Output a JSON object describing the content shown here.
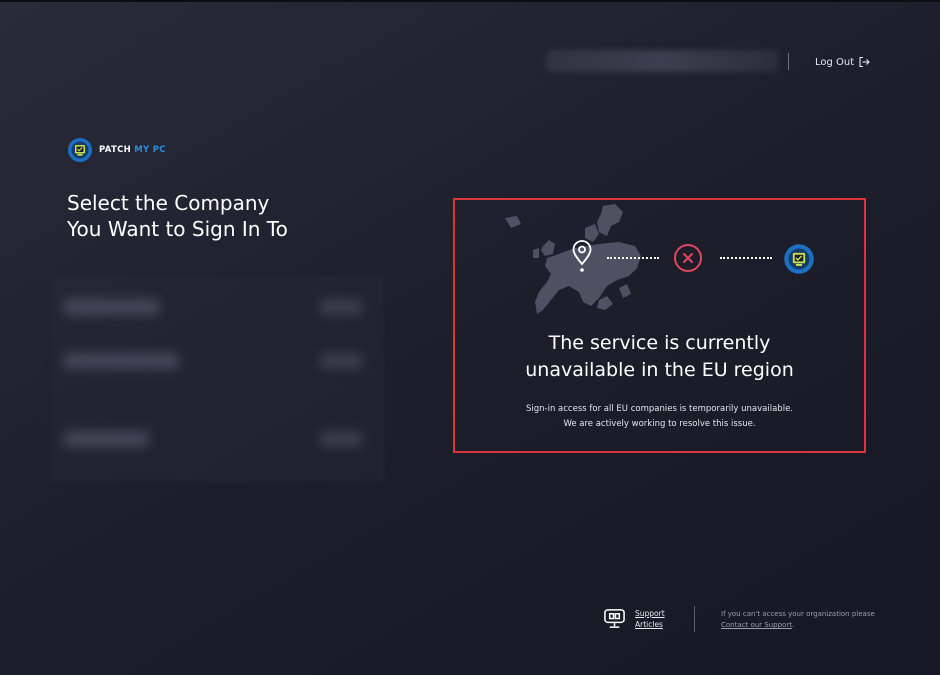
{
  "header": {
    "logout_label": "Log Out",
    "logout_icon": "logout-arrow-icon"
  },
  "brand": {
    "name_part1": "PATCH",
    "name_part2": "MY PC",
    "logo_icon": "patch-my-pc-shield-logo",
    "accent_color": "#2a8fe0"
  },
  "page": {
    "title": "Select the Company\nYou Want to Sign In To"
  },
  "notice": {
    "title": "The service is currently\nunavailable in the EU region",
    "body": "Sign-in access for all EU companies is temporarily unavailable.\nWe are actively working to resolve this issue.",
    "border_color": "#d9353a",
    "error_color": "#e2455f",
    "icons": [
      "europe-map-icon",
      "location-pin-icon",
      "error-x-icon",
      "patch-my-pc-shield-logo"
    ]
  },
  "footer": {
    "support_label": "Support\nArticles",
    "support_icon": "support-monitor-icon",
    "help_prefix": "If you can't access your organization please ",
    "help_link": "Contact our Support",
    "help_suffix": "."
  }
}
